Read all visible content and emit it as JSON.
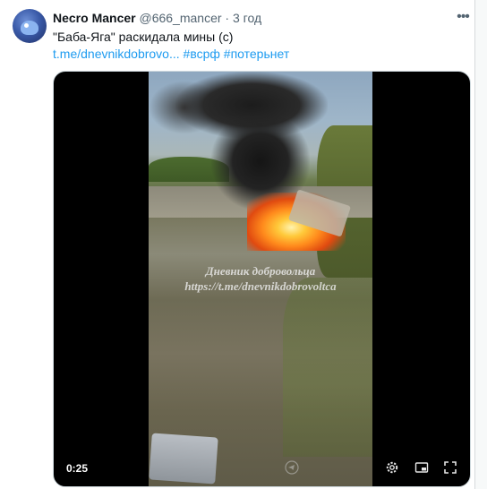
{
  "tweet": {
    "author_name": "Necro Mancer",
    "author_handle": "@666_mancer",
    "separator": "·",
    "time": "3 год",
    "text": "\"Баба-Яга\" раскидала мины (с)",
    "link": "t.me/dnevnikdobrovo...",
    "hashtags": [
      "#всрф",
      "#потерьнет"
    ]
  },
  "video": {
    "watermark_line1": "Дневник добровольца",
    "watermark_line2": "https://t.me/dnevnikdobrovoltca",
    "timestamp": "0:25"
  },
  "icons": {
    "more": "more-horizontal-icon",
    "settings": "gear-icon",
    "picture_in_picture": "picture-in-picture-icon",
    "fullscreen": "fullscreen-icon",
    "watermark_logo": "telegram-watermark-icon"
  },
  "colors": {
    "link": "#1d9bf0",
    "text": "#0f1419",
    "secondary": "#536471"
  }
}
